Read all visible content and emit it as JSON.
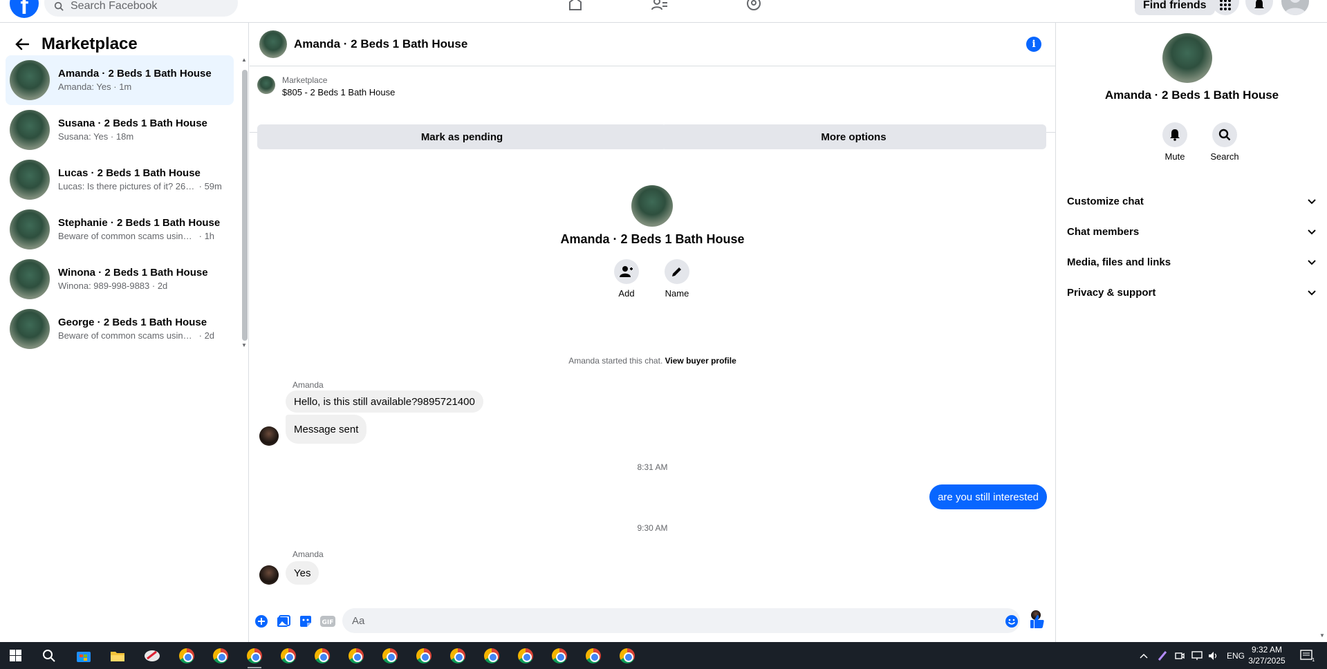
{
  "topbar": {
    "search_placeholder": "Search Facebook",
    "find_friends": "Find friends"
  },
  "sidebar": {
    "title": "Marketplace",
    "conversations": [
      {
        "name": "Amanda · 2 Beds 1 Bath House",
        "preview": "Amanda: Yes",
        "time": "1m",
        "active": true
      },
      {
        "name": "Susana · 2 Beds 1 Bath House",
        "preview": "Susana: Yes",
        "time": "18m"
      },
      {
        "name": "Lucas · 2 Beds 1 Bath House",
        "preview": "Lucas: Is there pictures of it? 260-...",
        "time": "59m"
      },
      {
        "name": "Stephanie · 2 Beds 1 Bath House",
        "preview": "Beware of common scams using pa...",
        "time": "1h"
      },
      {
        "name": "Winona · 2 Beds 1 Bath House",
        "preview": "Winona: 989-998-9883",
        "time": "2d"
      },
      {
        "name": "George · 2 Beds 1 Bath House",
        "preview": "Beware of common scams using pa...",
        "time": "2d"
      }
    ]
  },
  "chat": {
    "title": "Amanda · 2 Beds 1 Bath House",
    "listing_source": "Marketplace",
    "listing_title": "$805 - 2 Beds 1 Bath House",
    "mark_pending": "Mark as pending",
    "more_options": "More options",
    "profile_name": "Amanda · 2 Beds 1 Bath House",
    "add_label": "Add",
    "name_label": "Name",
    "started_text": "Amanda started this chat.",
    "view_buyer": "View buyer profile",
    "sender_1": "Amanda",
    "msg_1": "Hello, is this still available?9895721400",
    "msg_2": "Message sent",
    "time_1": "8:31 AM",
    "msg_out": "are you still interested",
    "time_2": "9:30 AM",
    "sender_2": "Amanda",
    "msg_3": "Yes",
    "composer_placeholder": "Aa"
  },
  "right_panel": {
    "name": "Amanda · 2 Beds 1 Bath House",
    "mute": "Mute",
    "search": "Search",
    "sections": [
      "Customize chat",
      "Chat members",
      "Media, files and links",
      "Privacy & support"
    ]
  },
  "taskbar": {
    "lang": "ENG",
    "time": "9:32 AM",
    "date": "3/27/2025",
    "notif_count": "11"
  },
  "colors": {
    "brand": "#0866ff",
    "active_row": "#ebf5ff",
    "button_gray": "#e4e6eb"
  }
}
